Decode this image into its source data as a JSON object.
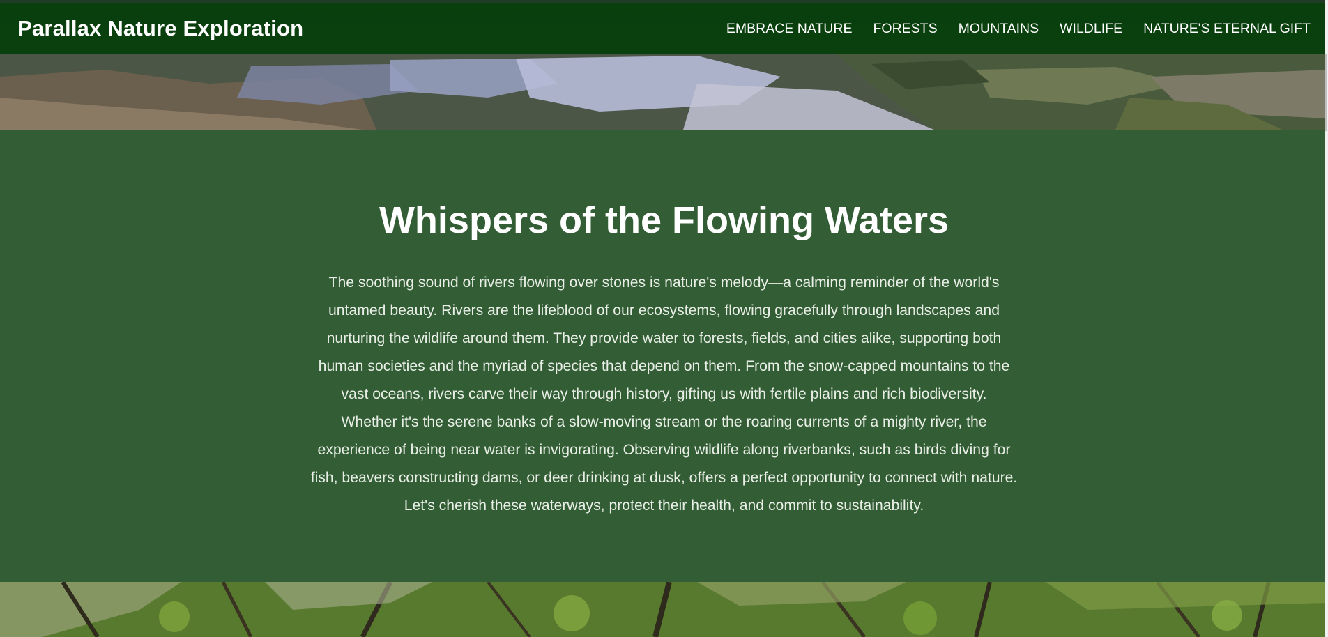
{
  "header": {
    "brand": "Parallax Nature Exploration",
    "nav": [
      "EMBRACE NATURE",
      "FORESTS",
      "MOUNTAINS",
      "WILDLIFE",
      "NATURE'S ETERNAL GIFT"
    ]
  },
  "section": {
    "title": "Whispers of the Flowing Waters",
    "paragraphs": [
      "The soothing sound of rivers flowing over stones is nature's melody—a calming reminder of the world's untamed beauty. Rivers are the lifeblood of our ecosystems, flowing gracefully through landscapes and nurturing the wildlife around them. They provide water to forests, fields, and cities alike, supporting both human societies and the myriad of species that depend on them. From the snow-capped mountains to the vast oceans, rivers carve their way through history, gifting us with fertile plains and rich biodiversity.",
      "Whether it's the serene banks of a slow-moving stream or the roaring currents of a mighty river, the experience of being near water is invigorating. Observing wildlife along riverbanks, such as birds diving for fish, beavers constructing dams, or deer drinking at dusk, offers a perfect opportunity to connect with nature. Let's cherish these waterways, protect their health, and commit to sustainability."
    ]
  },
  "colors": {
    "header_bg": "#08400c",
    "section_bg": "#335d35",
    "text": "#e9efe7"
  }
}
